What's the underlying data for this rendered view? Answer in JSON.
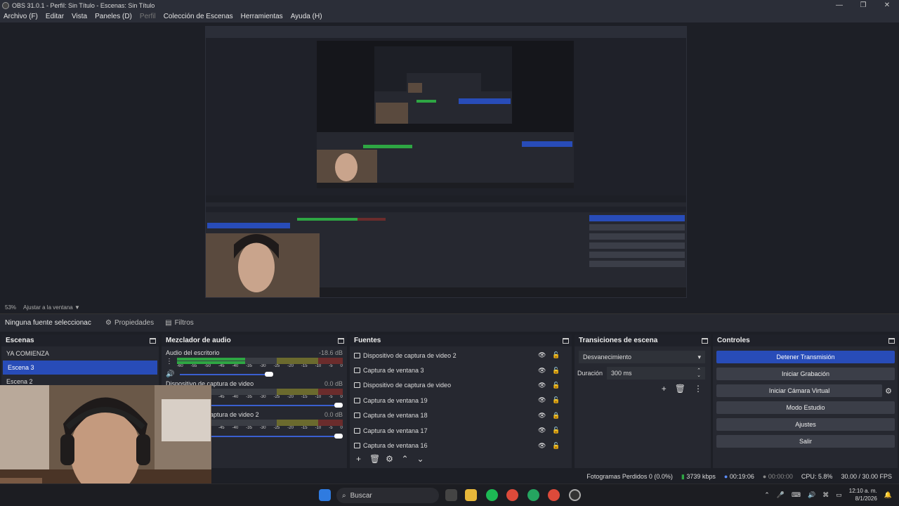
{
  "window": {
    "title": "OBS 31.0.1 - Perfil: Sin Título - Escenas: Sin Título",
    "minimize": "—",
    "maximize": "❐",
    "close": "✕"
  },
  "menu": [
    {
      "label": "Archivo (F)",
      "enabled": true
    },
    {
      "label": "Editar",
      "enabled": true
    },
    {
      "label": "Vista",
      "enabled": true
    },
    {
      "label": "Paneles (D)",
      "enabled": true
    },
    {
      "label": "Perfil",
      "enabled": false
    },
    {
      "label": "Colección de Escenas",
      "enabled": true
    },
    {
      "label": "Herramientas",
      "enabled": true
    },
    {
      "label": "Ayuda (H)",
      "enabled": true
    }
  ],
  "preview": {
    "scale": "53%",
    "fit_label": "Ajustar a la ventana"
  },
  "props": {
    "no_source": "Ninguna fuente seleccionac",
    "properties": "Propiedades",
    "filters": "Filtros"
  },
  "scenes": {
    "title": "Escenas",
    "items": [
      "YA COMIENZA",
      "Escena 3",
      "Escena 2"
    ],
    "selected_index": 1
  },
  "mixer": {
    "title": "Mezclador de audio",
    "tracks": [
      {
        "name": "Audio del escritorio",
        "db": "-18.6 dB",
        "level": 0.41,
        "volume": 0.58
      },
      {
        "name": "Dispositivo de captura de video",
        "db": "0.0 dB",
        "level": 0.0,
        "volume": 1.0
      },
      {
        "name": "Dispositivo de captura de video 2",
        "db": "0.0 dB",
        "level": 0.0,
        "volume": 1.0
      }
    ],
    "ticks": [
      "-60",
      "-55",
      "-50",
      "-45",
      "-40",
      "-35",
      "-30",
      "-25",
      "-20",
      "-15",
      "-10",
      "-5",
      "0"
    ]
  },
  "sources": {
    "title": "Fuentes",
    "items": [
      {
        "name": "Dispositivo de captura de video 2",
        "icon": "camera-icon",
        "locked": false
      },
      {
        "name": "Captura de ventana 3",
        "icon": "window-icon",
        "locked": false
      },
      {
        "name": "Dispositivo de captura de video",
        "icon": "camera-icon",
        "locked": false
      },
      {
        "name": "Captura de ventana 19",
        "icon": "window-icon",
        "locked": false
      },
      {
        "name": "Captura de ventana 18",
        "icon": "window-icon",
        "locked": true
      },
      {
        "name": "Captura de ventana 17",
        "icon": "window-icon",
        "locked": false
      },
      {
        "name": "Captura de ventana 16",
        "icon": "window-icon",
        "locked": false
      }
    ]
  },
  "transitions": {
    "title": "Transiciones de escena",
    "selected": "Desvanecimiento",
    "duration_label": "Duración",
    "duration_value": "300 ms"
  },
  "controls": {
    "title": "Controles",
    "stop_stream": "Detener Transmisión",
    "start_recording": "Iniciar Grabación",
    "start_virtual_cam": "Iniciar Cámara Virtual",
    "studio_mode": "Modo Estudio",
    "settings": "Ajustes",
    "exit": "Salir"
  },
  "status": {
    "dropped_frames": "Fotogramas Perdidos 0 (0.0%)",
    "bitrate": "3739 kbps",
    "stream_time": "00:19:06",
    "record_time": "00:00:00",
    "cpu": "CPU: 5.8%",
    "fps": "30.00 / 30.00 FPS"
  },
  "taskbar": {
    "search_placeholder": "Buscar",
    "time": "12:10 a. m.",
    "date": "8/1/2026"
  },
  "colors": {
    "accent": "#284cb8",
    "background": "#1d1f26",
    "panel": "#262830",
    "meter_green": "#2ea643"
  }
}
